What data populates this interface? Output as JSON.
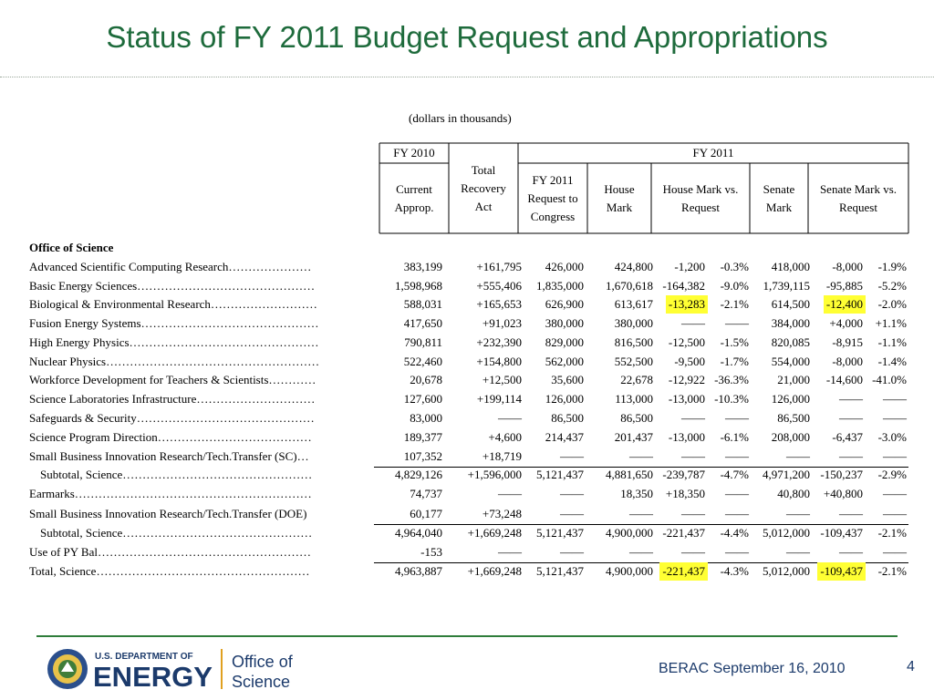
{
  "title": "Status of FY 2011 Budget Request and Appropriations",
  "unit_note": "(dollars in thousands)",
  "headers": {
    "fy2010": "FY 2010",
    "fy2011": "FY 2011",
    "cols": [
      [
        "Current",
        "Approp."
      ],
      [
        "Total",
        "Recovery",
        "Act"
      ],
      [
        "FY 2011",
        "Request to",
        "Congress"
      ],
      [
        "House",
        "Mark"
      ],
      [
        "House Mark vs.",
        "Request"
      ],
      [
        "Senate",
        "Mark"
      ],
      [
        "Senate Mark vs.",
        "Request"
      ]
    ]
  },
  "section_label": "Office of Science",
  "rows": [
    {
      "label": "Advanced Scientific Computing Research…………………",
      "v": [
        "383,199",
        "+161,795",
        "426,000",
        "424,800",
        "-1,200",
        "-0.3%",
        "418,000",
        "-8,000",
        "-1.9%"
      ]
    },
    {
      "label": "Basic Energy Sciences………………………………………",
      "v": [
        "1,598,968",
        "+555,406",
        "1,835,000",
        "1,670,618",
        "-164,382",
        "-9.0%",
        "1,739,115",
        "-95,885",
        "-5.2%"
      ]
    },
    {
      "label": "Biological & Environmental Research………………………",
      "v": [
        "588,031",
        "+165,653",
        "626,900",
        "613,617",
        "-13,283",
        "-2.1%",
        "614,500",
        "-12,400",
        "-2.0%"
      ],
      "hl": [
        4,
        7
      ]
    },
    {
      "label": "Fusion Energy Systems………………………………………",
      "v": [
        "417,650",
        "+91,023",
        "380,000",
        "380,000",
        "——",
        "——",
        "384,000",
        "+4,000",
        "+1.1%"
      ]
    },
    {
      "label": "High Energy Physics…………………………………………",
      "v": [
        "790,811",
        "+232,390",
        "829,000",
        "816,500",
        "-12,500",
        "-1.5%",
        "820,085",
        "-8,915",
        "-1.1%"
      ]
    },
    {
      "label": "Nuclear Physics………………………………………………",
      "v": [
        "522,460",
        "+154,800",
        "562,000",
        "552,500",
        "-9,500",
        "-1.7%",
        "554,000",
        "-8,000",
        "-1.4%"
      ]
    },
    {
      "label": "Workforce Development for Teachers & Scientists…………",
      "v": [
        "20,678",
        "+12,500",
        "35,600",
        "22,678",
        "-12,922",
        "-36.3%",
        "21,000",
        "-14,600",
        "-41.0%"
      ]
    },
    {
      "label": "Science Laboratories Infrastructure…………………………",
      "v": [
        "127,600",
        "+199,114",
        "126,000",
        "113,000",
        "-13,000",
        "-10.3%",
        "126,000",
        "——",
        "——"
      ]
    },
    {
      "label": "Safeguards & Security………………………………………",
      "v": [
        "83,000",
        "——",
        "86,500",
        "86,500",
        "——",
        "——",
        "86,500",
        "——",
        "——"
      ]
    },
    {
      "label": "Science Program Direction…………………………………",
      "v": [
        "189,377",
        "+4,600",
        "214,437",
        "201,437",
        "-13,000",
        "-6.1%",
        "208,000",
        "-6,437",
        "-3.0%"
      ]
    },
    {
      "label": "Small Business Innovation Research/Tech.Transfer (SC)…",
      "v": [
        "107,352",
        "+18,719",
        "——",
        "——",
        "——",
        "——",
        "——",
        "——",
        "——"
      ],
      "ul": true
    },
    {
      "label": "Subtotal, Science…………………………………………",
      "indent": true,
      "v": [
        "4,829,126",
        "+1,596,000",
        "5,121,437",
        "4,881,650",
        "-239,787",
        "-4.7%",
        "4,971,200",
        "-150,237",
        "-2.9%"
      ]
    },
    {
      "label": "Earmarks……………………………………………………",
      "v": [
        "74,737",
        "——",
        "——",
        "18,350",
        "+18,350",
        "——",
        "40,800",
        "+40,800",
        "——"
      ]
    },
    {
      "label": "Small Business Innovation Research/Tech.Transfer (DOE)",
      "v": [
        "60,177",
        "+73,248",
        "——",
        "——",
        "——",
        "——",
        "——",
        "——",
        "——"
      ],
      "ul": true
    },
    {
      "label": "Subtotal, Science…………………………………………",
      "indent": true,
      "v": [
        "4,964,040",
        "+1,669,248",
        "5,121,437",
        "4,900,000",
        "-221,437",
        "-4.4%",
        "5,012,000",
        "-109,437",
        "-2.1%"
      ]
    },
    {
      "label": "Use of PY Bal………………………………………………",
      "v": [
        "-153",
        "——",
        "——",
        "——",
        "——",
        "——",
        "——",
        "——",
        "——"
      ],
      "ul": true
    },
    {
      "label": "Total, Science………………………………………………",
      "v": [
        "4,963,887",
        "+1,669,248",
        "5,121,437",
        "4,900,000",
        "-221,437",
        "-4.3%",
        "5,012,000",
        "-109,437",
        "-2.1%"
      ],
      "hl": [
        4,
        7
      ]
    }
  ],
  "logo": {
    "dept_line": "U.S. DEPARTMENT OF",
    "energy_word": "ENERGY",
    "office_line1": "Office of",
    "office_line2": "Science"
  },
  "footer_text": "BERAC September 16, 2010",
  "page_number": "4",
  "colors": {
    "title": "#1e6b3c",
    "highlight": "#ffff33",
    "footer": "#1b3a6b"
  }
}
